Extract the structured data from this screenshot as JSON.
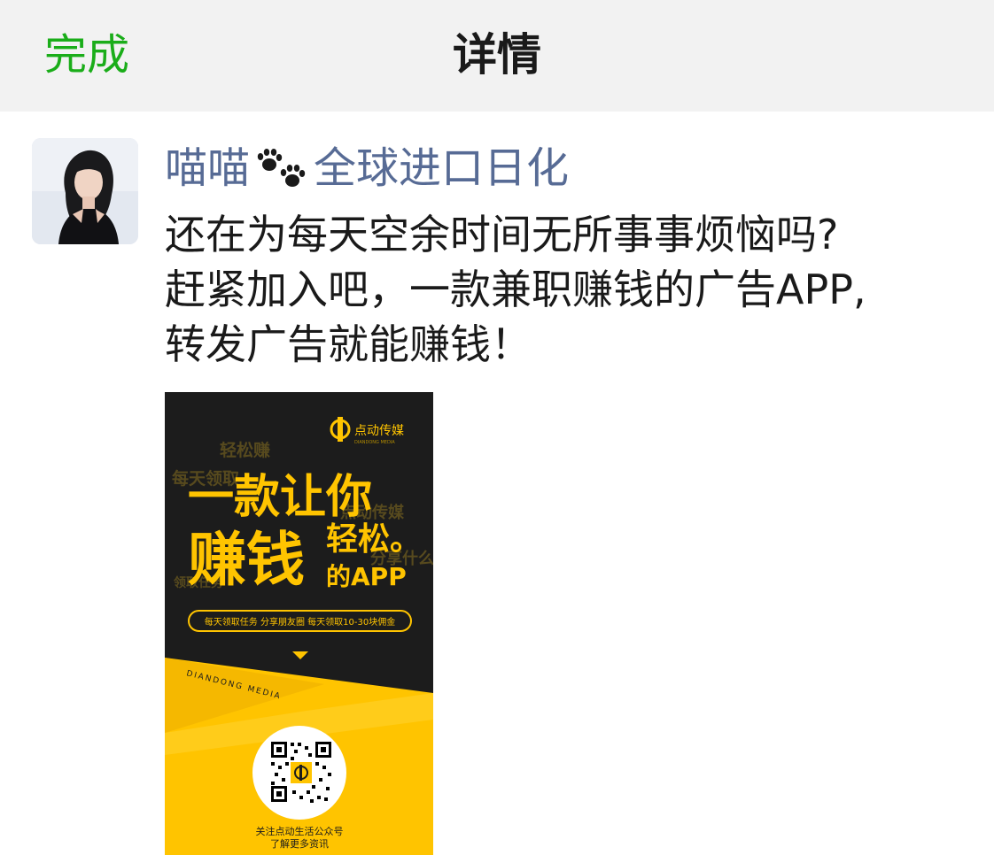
{
  "navbar": {
    "done_label": "完成",
    "title": "详情"
  },
  "post": {
    "author_prefix": "喵喵",
    "author_suffix": "全球进口日化",
    "author_icon": "paw-prints-icon",
    "text_lines": [
      "还在为每天空余时间无所事事烦恼吗?",
      "赶紧加入吧，一款兼职赚钱的广告APP,",
      "转发广告就能赚钱！"
    ]
  },
  "poster": {
    "brand": "点动传媒",
    "brand_sub": "DIANDONG MEDIA",
    "bg_words": [
      "轻松赚",
      "每天领取",
      "点动传媒",
      "分享什么",
      "领取任务"
    ],
    "headline_1": "一款让你",
    "headline_2": "赚钱",
    "headline_3": "轻松。",
    "headline_4": "的APP",
    "pill_text": "每天领取任务  分享朋友圈  每天领取10-30块佣金",
    "diagonal_text": "DIANDONG MEDIA",
    "caption_1": "关注点动生活公众号",
    "caption_2": "了解更多资讯",
    "colors": {
      "yellow": "#ffc400",
      "dark": "#1c1c1c",
      "accent_text": "#574a1e"
    }
  }
}
